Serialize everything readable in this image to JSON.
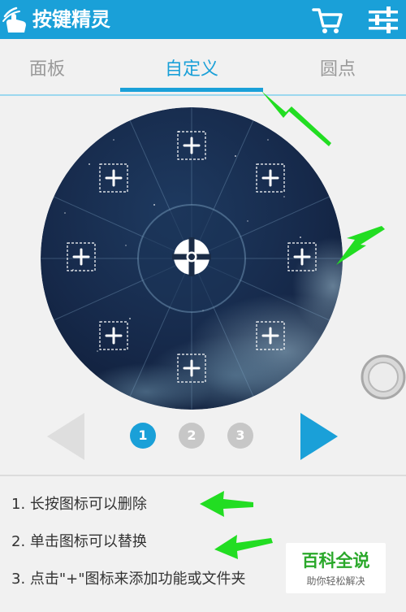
{
  "app": {
    "title": "按键精灵",
    "icon": "hand-tap-icon"
  },
  "toolbar": {
    "cart_icon": "shopping-cart-icon",
    "settings_icon": "sliders-settings-icon"
  },
  "tabs": [
    {
      "label": "面板",
      "active": false
    },
    {
      "label": "自定义",
      "active": true
    },
    {
      "label": "圆点",
      "active": false
    }
  ],
  "wheel": {
    "center_icon": "crosshair-icon",
    "slot_icon": "plus-icon",
    "slots": 8
  },
  "pager": {
    "prev_icon": "left-triangle-icon",
    "next_icon": "right-triangle-icon",
    "pages": [
      "1",
      "2",
      "3"
    ],
    "current": "1"
  },
  "float_ball_icon": "floating-ball-icon",
  "instructions": [
    "1. 长按图标可以删除",
    "2. 单击图标可以替换",
    "3. 点击\"+\"图标来添加功能或文件夹"
  ],
  "watermark": {
    "title": "百科全说",
    "subtitle": "助你轻松解决"
  },
  "colors": {
    "accent": "#1aa0d8",
    "arrow": "#22dd22",
    "watermark_green": "#2aa82a"
  }
}
